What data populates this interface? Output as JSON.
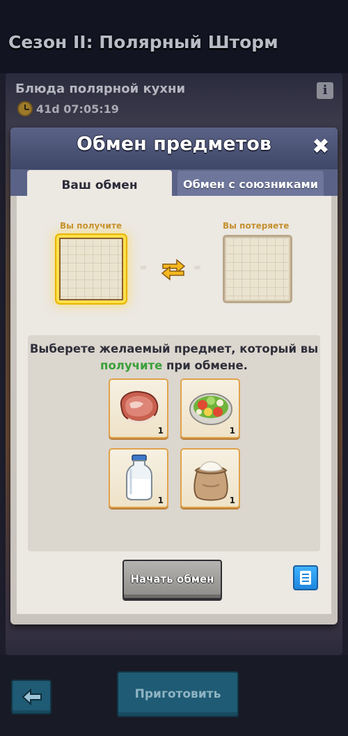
{
  "background": {
    "season_title": "Сезон II: Полярный Шторм",
    "event_title": "Блюда полярной кухни",
    "timer": "41d 07:05:19",
    "info_icon": "info-icon",
    "cook_button_label": "Приготовить",
    "back_icon": "back-arrow-icon"
  },
  "modal": {
    "title": "Обмен предметов",
    "close_icon": "close-icon",
    "tabs": [
      {
        "label": "Ваш обмен",
        "active": true
      },
      {
        "label": "Обмен с союзниками",
        "active": false
      }
    ],
    "receive_label": "Вы получите",
    "lose_label": "Вы потеряете",
    "instruction_before": "Выберете желаемый предмет, который вы ",
    "instruction_highlight": "получите",
    "instruction_after": " при обмене.",
    "items": [
      {
        "name": "steak",
        "icon": "steak-icon",
        "count": "1"
      },
      {
        "name": "salad",
        "icon": "salad-icon",
        "count": "1"
      },
      {
        "name": "milk",
        "icon": "milk-bottle-icon",
        "count": "1"
      },
      {
        "name": "flour",
        "icon": "flour-sack-icon",
        "count": "1"
      }
    ],
    "start_button_label": "Начать обмен",
    "log_icon": "scroll-log-icon"
  },
  "colors": {
    "highlight_green": "#3aa03a",
    "receive_glow": "#ffe14a",
    "label_gold": "#c4902e",
    "header_blue": "#4a5274"
  }
}
